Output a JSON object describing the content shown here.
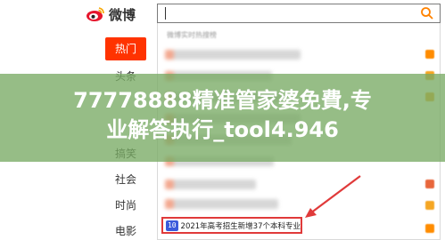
{
  "app": {
    "logo_text": "微博"
  },
  "nav": {
    "items": [
      {
        "label": "热门",
        "active": true
      },
      {
        "label": "头条",
        "active": false
      },
      {
        "label": "",
        "active": false
      },
      {
        "label": "",
        "active": false
      },
      {
        "label": "搞笑",
        "active": false
      },
      {
        "label": "社会",
        "active": false
      },
      {
        "label": "时尚",
        "active": false
      },
      {
        "label": "电影",
        "active": false
      }
    ]
  },
  "search": {
    "value": "",
    "dropdown_header": "微博实时热搜榜",
    "last_item": {
      "rank": "10",
      "text": "2021年高考招生新增37个本科专业"
    }
  },
  "overlay": {
    "line1": "77778888精准管家婆免費,专",
    "line2": "业解答执行_tool4.946"
  },
  "colors": {
    "brand": "#ff3300",
    "highlight_border": "#e03a3a",
    "overlay": "#78aa64",
    "rank_badge": "#3b5bdb"
  }
}
